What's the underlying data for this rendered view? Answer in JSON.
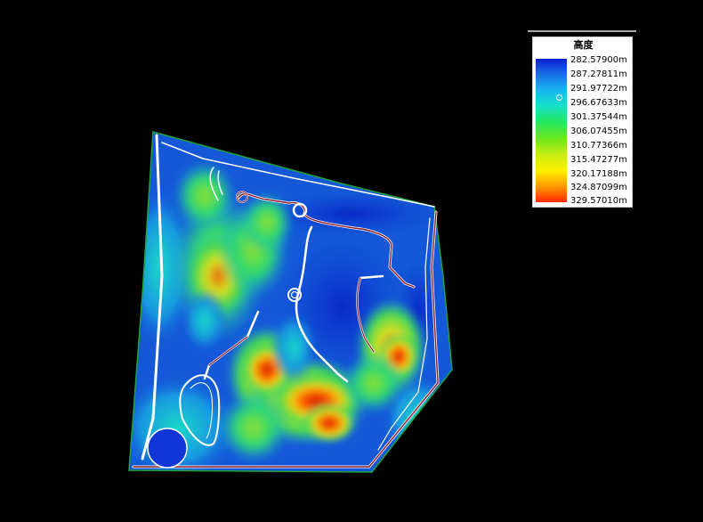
{
  "legend": {
    "title": "高度",
    "labels": [
      "282.57900m",
      "287.27811m",
      "291.97722m",
      "296.67633m",
      "301.37544m",
      "306.07455m",
      "310.77366m",
      "315.47277m",
      "320.17188m",
      "324.87099m",
      "329.57010m"
    ],
    "colors": [
      "#0a1fd2",
      "#1a6fe8",
      "#16b8f0",
      "#19e0c8",
      "#22e860",
      "#6ee81e",
      "#c8ec14",
      "#fff000",
      "#ff9a00",
      "#ff2a00"
    ]
  },
  "map": {
    "boundary_color": "#1fa23a",
    "road_color": "#8b1a2a",
    "road_edge_color": "#ffffff"
  }
}
